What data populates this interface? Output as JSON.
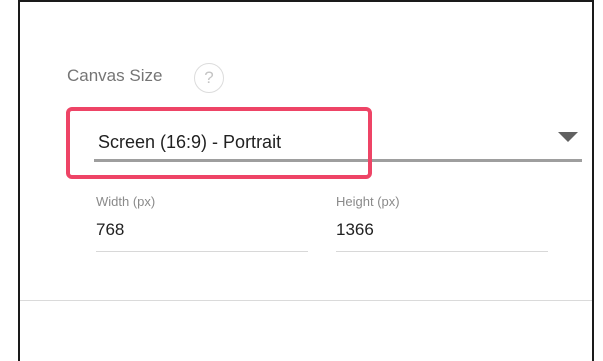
{
  "canvas_size": {
    "label": "Canvas Size",
    "help_glyph": "?",
    "selected_option": "Screen (16:9) - Portrait",
    "width_label": "Width (px)",
    "width_value": "768",
    "height_label": "Height (px)",
    "height_value": "1366"
  },
  "colors": {
    "highlight": "#ee4466",
    "underline": "#9e9e9e",
    "label": "#757575"
  },
  "icons": {
    "help": "help-circle-icon",
    "dropdown": "dropdown-caret-icon"
  }
}
